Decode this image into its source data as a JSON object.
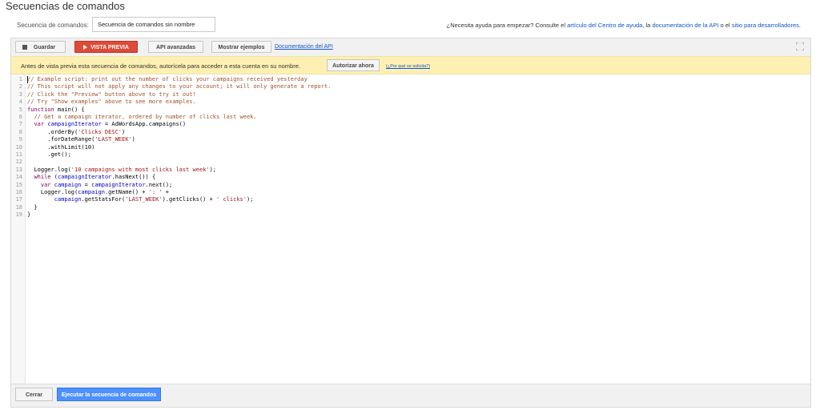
{
  "page": {
    "title": "Secuencias de comandos"
  },
  "script_name": {
    "label": "Secuencia de comandos:",
    "value": "Secuencia de comandos sin nombre"
  },
  "help": {
    "prefix": "¿Necesita ayuda para empezar? Consulte el ",
    "link1": "artículo del Centro de ayuda",
    "sep1": ", la ",
    "link2": "documentación de la API",
    "sep2": " o el ",
    "link3": "sitio para desarrolladores",
    "suffix": "."
  },
  "toolbar": {
    "save_label": "Guardar",
    "preview_label": "VISTA PREVIA",
    "advanced_api_label": "API avanzadas",
    "show_examples_label": "Mostrar ejemplos",
    "api_docs_label": "Documentación del API",
    "expand_icon": "expand-icon"
  },
  "notice": {
    "text": "Antes de vista previa esta secuencia de comandos, autorícela para acceder a esta cuenta en su nombre.",
    "authorize_label": "Autorizar ahora",
    "why_label": "(¿Por qué se solicita?)"
  },
  "code_lines": [
    "// Example script: print out the number of clicks your campaigns received yesterday",
    "// This script will not apply any changes to your account; it will only generate a report.",
    "// Click the \"Preview\" button above to try it out!",
    "// Try \"Show examples\" above to see more examples.",
    "function main() {",
    "  // Get a campaign iterator, ordered by number of clicks last week.",
    "  var campaignIterator = AdWordsApp.campaigns()",
    "      .orderBy('Clicks DESC')",
    "      .forDateRange('LAST_WEEK')",
    "      .withLimit(10)",
    "      .get();",
    "",
    "  Logger.log('10 campaigns with most clicks last week');",
    "  while (campaignIterator.hasNext()) {",
    "    var campaign = campaignIterator.next();",
    "    Logger.log(campaign.getName() + ': ' +",
    "        campaign.getStatsFor('LAST_WEEK').getClicks() + ' clicks');",
    "  }",
    "}"
  ],
  "footer": {
    "close_label": "Cerrar",
    "run_label": "Ejecutar la secuencia de comandos"
  },
  "colors": {
    "preview_button": "#dd4b39",
    "run_button": "#4d90fe",
    "notice_bg": "#fdf0b2",
    "link": "#1155cc"
  }
}
